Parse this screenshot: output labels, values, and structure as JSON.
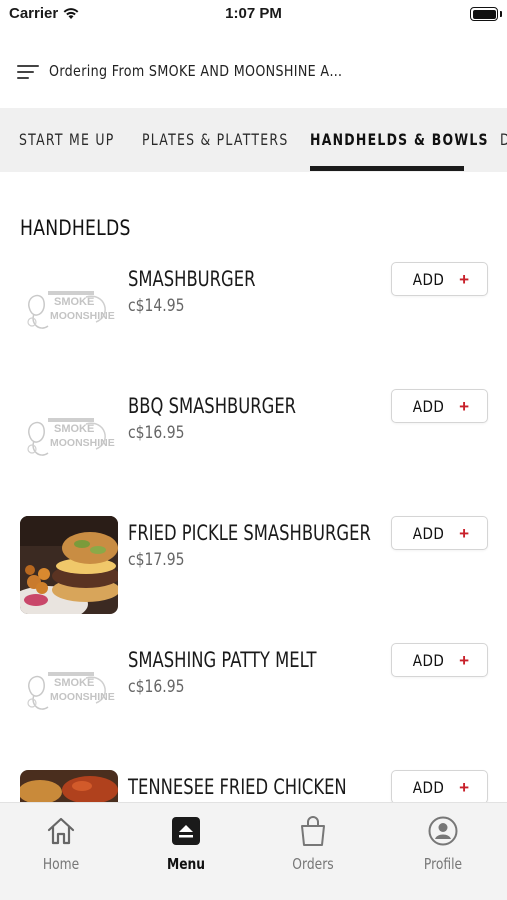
{
  "status": {
    "carrier": "Carrier",
    "time": "1:07 PM"
  },
  "header": {
    "title": "Ordering From SMOKE AND MOONSHINE AUTHENTIC…"
  },
  "tabs": [
    {
      "label": "START ME UP"
    },
    {
      "label": "PLATES & PLATTERS"
    },
    {
      "label": "HANDHELDS & BOWLS",
      "active": true
    },
    {
      "label": "D"
    }
  ],
  "section": {
    "title": "HANDHELDS"
  },
  "items": [
    {
      "name": "SMASHBURGER",
      "price": "c$14.95",
      "image": "logo-placeholder",
      "add_label": "ADD",
      "add_icon": "+"
    },
    {
      "name": "BBQ SMASHBURGER",
      "price": "c$16.95",
      "image": "logo-placeholder",
      "add_label": "ADD",
      "add_icon": "+"
    },
    {
      "name": "FRIED PICKLE SMASHBURGER",
      "price": "c$17.95",
      "image": "burger-photo",
      "add_label": "ADD",
      "add_icon": "+"
    },
    {
      "name": "SMASHING PATTY MELT",
      "price": "c$16.95",
      "image": "logo-placeholder",
      "add_label": "ADD",
      "add_icon": "+"
    },
    {
      "name": "TENNESEE FRIED CHICKEN",
      "price": "",
      "image": "chicken-photo",
      "add_label": "ADD",
      "add_icon": "+"
    }
  ],
  "logo": {
    "line1": "SMOKE",
    "line2": "MOONSHINE"
  },
  "nav": [
    {
      "label": "Home",
      "icon": "home-icon"
    },
    {
      "label": "Menu",
      "icon": "menu-icon",
      "active": true
    },
    {
      "label": "Orders",
      "icon": "bag-icon"
    },
    {
      "label": "Profile",
      "icon": "profile-icon"
    }
  ],
  "colors": {
    "accent": "#c8202a",
    "tab_bar_bg": "#f0f0f0",
    "nav_bg": "#f3f3f3"
  }
}
